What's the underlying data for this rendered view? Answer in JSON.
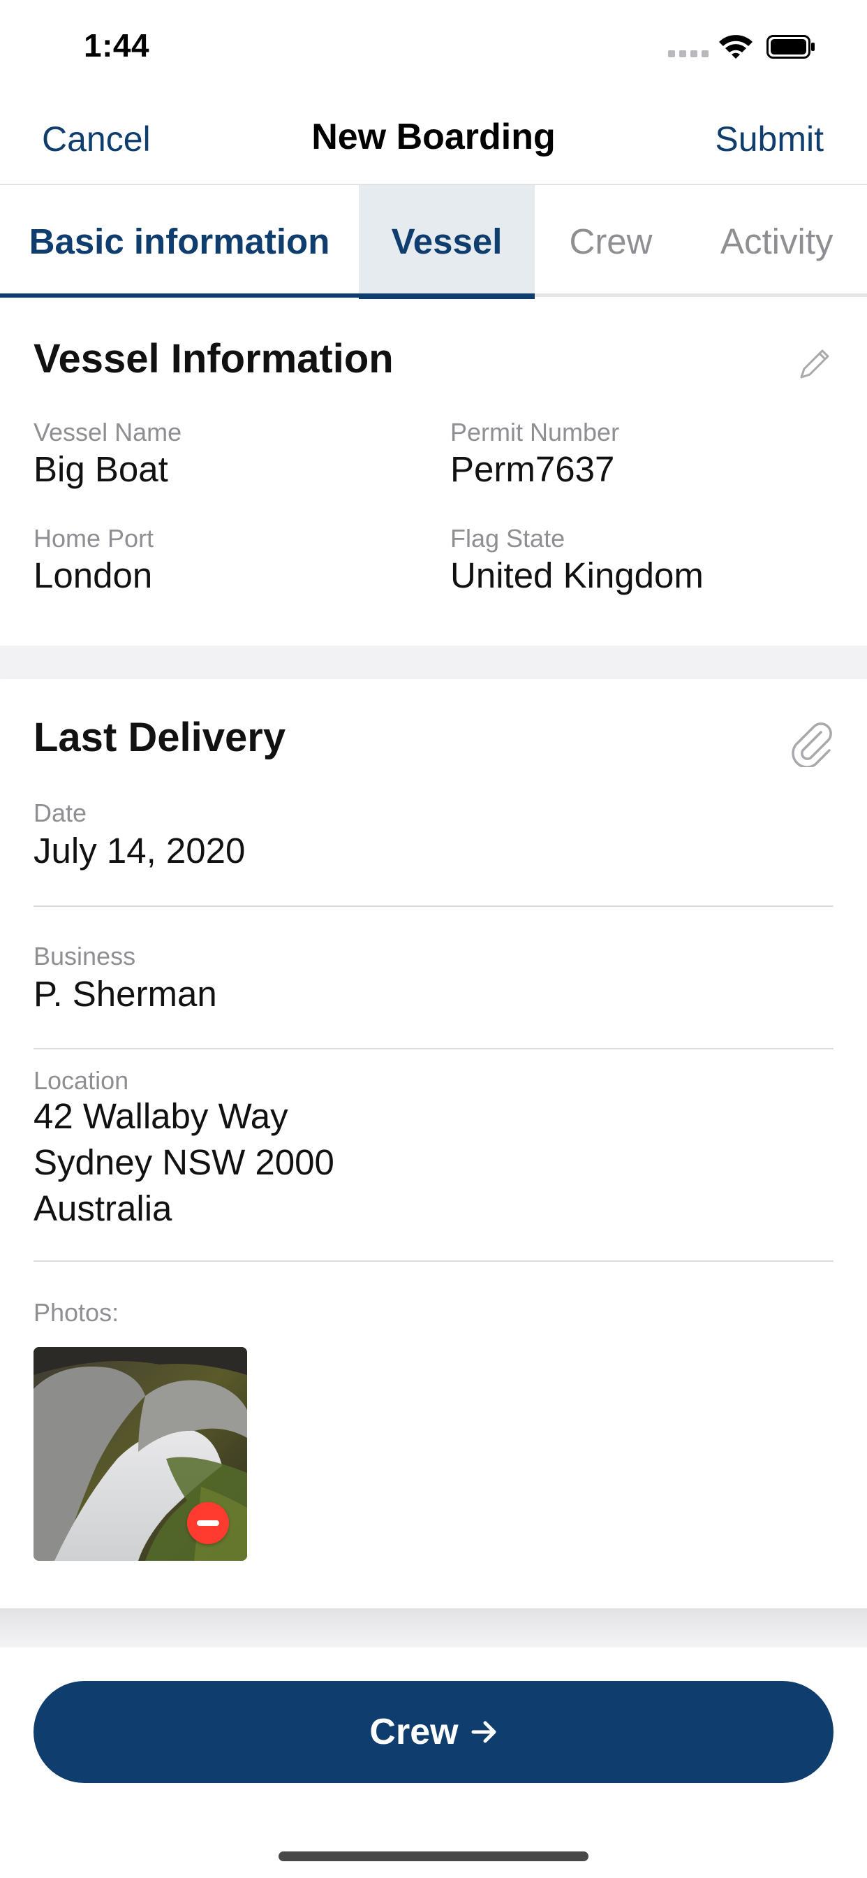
{
  "status_bar": {
    "time": "1:44"
  },
  "nav": {
    "cancel_label": "Cancel",
    "title": "New Boarding",
    "submit_label": "Submit"
  },
  "tabs": [
    {
      "label": "Basic information",
      "state": "completed"
    },
    {
      "label": "Vessel",
      "state": "active"
    },
    {
      "label": "Crew",
      "state": "inactive"
    },
    {
      "label": "Activity",
      "state": "inactive"
    }
  ],
  "vessel_info": {
    "title": "Vessel Information",
    "edit_icon": "pencil-icon",
    "fields": [
      {
        "label": "Vessel Name",
        "value": "Big Boat"
      },
      {
        "label": "Permit Number",
        "value": "Perm7637"
      },
      {
        "label": "Home Port",
        "value": "London"
      },
      {
        "label": "Flag State",
        "value": "United Kingdom"
      }
    ]
  },
  "last_delivery": {
    "title": "Last Delivery",
    "attach_icon": "paperclip-icon",
    "date": {
      "label": "Date",
      "value": "July 14, 2020"
    },
    "business": {
      "label": "Business",
      "value": "P. Sherman"
    },
    "location": {
      "label": "Location",
      "lines": [
        "42 Wallaby Way",
        "Sydney NSW 2000",
        "Australia"
      ]
    },
    "photos_label": "Photos:",
    "photos": [
      {
        "subject": "waterfall",
        "removable": true
      }
    ]
  },
  "next_button": {
    "label": "Crew",
    "icon": "arrow-right-icon"
  },
  "colors": {
    "primary": "#0f3d6e",
    "inactive_tab": "#8e8e93",
    "label": "#8e8e93",
    "remove_badge": "#ff3b30",
    "active_tab_bg": "#e6ebf0"
  }
}
